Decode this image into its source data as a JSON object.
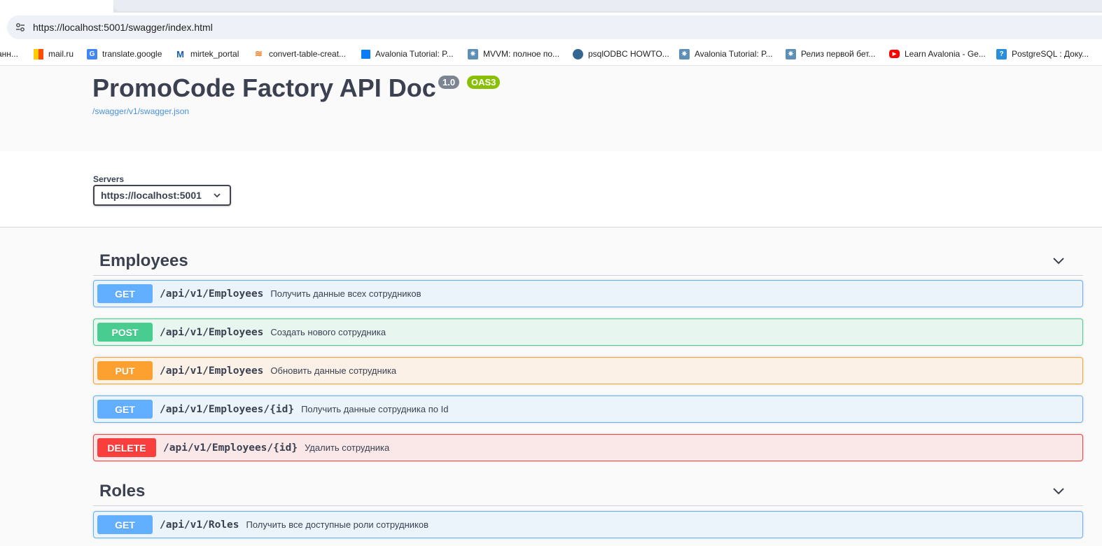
{
  "browser": {
    "url": "https://localhost:5001/swagger/index.html",
    "bookmarks": [
      {
        "label": "анн...",
        "icon": "none"
      },
      {
        "label": "mail.ru",
        "icon": "mailru-flag-icon",
        "color": "#ff9e00"
      },
      {
        "label": "translate.google",
        "icon": "google-translate-icon",
        "color": "#4285f4"
      },
      {
        "label": "mirtek_portal",
        "icon": "mirtek-m-icon",
        "color": "#1a5ea8"
      },
      {
        "label": "convert-table-creat...",
        "icon": "stackoverflow-icon",
        "color": "#f48024"
      },
      {
        "label": "Avalonia Tutorial: P...",
        "icon": "blue-square-icon",
        "color": "#0a7cf5"
      },
      {
        "label": "MVVM: полное по...",
        "icon": "habr-gear-icon",
        "color": "#5e8fb5"
      },
      {
        "label": "psqlODBC HOWTO...",
        "icon": "postgres-elephant-icon",
        "color": "#336791"
      },
      {
        "label": "Avalonia Tutorial: P...",
        "icon": "habr-gear-icon",
        "color": "#5e8fb5"
      },
      {
        "label": "Релиз первой бет...",
        "icon": "habr-gear-icon",
        "color": "#5e8fb5"
      },
      {
        "label": "Learn Avalonia - Ge...",
        "icon": "youtube-icon",
        "color": "#ff0000"
      },
      {
        "label": "PostgreSQL : Доку...",
        "icon": "postgres-help-icon",
        "color": "#2a8fd8"
      }
    ]
  },
  "info": {
    "title": "PromoCode Factory API Doc",
    "version": "1.0",
    "oas": "OAS3",
    "json_link": "/swagger/v1/swagger.json"
  },
  "servers": {
    "label": "Servers",
    "selected": "https://localhost:5001"
  },
  "sections": [
    {
      "name": "Employees",
      "operations": [
        {
          "method": "GET",
          "path": "/api/v1/Employees",
          "summary": "Получить данные всех сотрудников"
        },
        {
          "method": "POST",
          "path": "/api/v1/Employees",
          "summary": "Создать нового сотрудника"
        },
        {
          "method": "PUT",
          "path": "/api/v1/Employees",
          "summary": "Обновить данные сотрудника"
        },
        {
          "method": "GET",
          "path": "/api/v1/Employees/{id}",
          "summary": "Получить данные сотрудника по Id"
        },
        {
          "method": "DELETE",
          "path": "/api/v1/Employees/{id}",
          "summary": "Удалить сотрудника"
        }
      ]
    },
    {
      "name": "Roles",
      "operations": [
        {
          "method": "GET",
          "path": "/api/v1/Roles",
          "summary": "Получить все доступные роли сотрудников"
        }
      ]
    }
  ],
  "colors": {
    "get": "#61affe",
    "post": "#49cc90",
    "put": "#fca130",
    "delete": "#f93e3e",
    "link": "#4990e2",
    "oas_badge": "#89bf04",
    "version_badge": "#7d8492"
  }
}
